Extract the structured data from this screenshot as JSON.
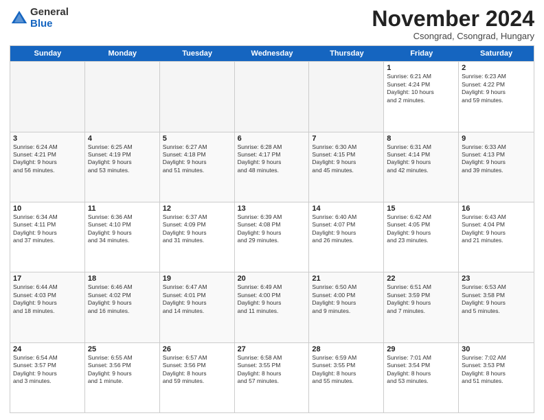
{
  "header": {
    "logo_line1": "General",
    "logo_line2": "Blue",
    "month": "November 2024",
    "location": "Csongrad, Csongrad, Hungary"
  },
  "weekdays": [
    "Sunday",
    "Monday",
    "Tuesday",
    "Wednesday",
    "Thursday",
    "Friday",
    "Saturday"
  ],
  "rows": [
    [
      {
        "day": "",
        "text": "",
        "empty": true
      },
      {
        "day": "",
        "text": "",
        "empty": true
      },
      {
        "day": "",
        "text": "",
        "empty": true
      },
      {
        "day": "",
        "text": "",
        "empty": true
      },
      {
        "day": "",
        "text": "",
        "empty": true
      },
      {
        "day": "1",
        "text": "Sunrise: 6:21 AM\nSunset: 4:24 PM\nDaylight: 10 hours\nand 2 minutes.",
        "empty": false
      },
      {
        "day": "2",
        "text": "Sunrise: 6:23 AM\nSunset: 4:22 PM\nDaylight: 9 hours\nand 59 minutes.",
        "empty": false
      }
    ],
    [
      {
        "day": "3",
        "text": "Sunrise: 6:24 AM\nSunset: 4:21 PM\nDaylight: 9 hours\nand 56 minutes.",
        "empty": false
      },
      {
        "day": "4",
        "text": "Sunrise: 6:25 AM\nSunset: 4:19 PM\nDaylight: 9 hours\nand 53 minutes.",
        "empty": false
      },
      {
        "day": "5",
        "text": "Sunrise: 6:27 AM\nSunset: 4:18 PM\nDaylight: 9 hours\nand 51 minutes.",
        "empty": false
      },
      {
        "day": "6",
        "text": "Sunrise: 6:28 AM\nSunset: 4:17 PM\nDaylight: 9 hours\nand 48 minutes.",
        "empty": false
      },
      {
        "day": "7",
        "text": "Sunrise: 6:30 AM\nSunset: 4:15 PM\nDaylight: 9 hours\nand 45 minutes.",
        "empty": false
      },
      {
        "day": "8",
        "text": "Sunrise: 6:31 AM\nSunset: 4:14 PM\nDaylight: 9 hours\nand 42 minutes.",
        "empty": false
      },
      {
        "day": "9",
        "text": "Sunrise: 6:33 AM\nSunset: 4:13 PM\nDaylight: 9 hours\nand 39 minutes.",
        "empty": false
      }
    ],
    [
      {
        "day": "10",
        "text": "Sunrise: 6:34 AM\nSunset: 4:11 PM\nDaylight: 9 hours\nand 37 minutes.",
        "empty": false
      },
      {
        "day": "11",
        "text": "Sunrise: 6:36 AM\nSunset: 4:10 PM\nDaylight: 9 hours\nand 34 minutes.",
        "empty": false
      },
      {
        "day": "12",
        "text": "Sunrise: 6:37 AM\nSunset: 4:09 PM\nDaylight: 9 hours\nand 31 minutes.",
        "empty": false
      },
      {
        "day": "13",
        "text": "Sunrise: 6:39 AM\nSunset: 4:08 PM\nDaylight: 9 hours\nand 29 minutes.",
        "empty": false
      },
      {
        "day": "14",
        "text": "Sunrise: 6:40 AM\nSunset: 4:07 PM\nDaylight: 9 hours\nand 26 minutes.",
        "empty": false
      },
      {
        "day": "15",
        "text": "Sunrise: 6:42 AM\nSunset: 4:05 PM\nDaylight: 9 hours\nand 23 minutes.",
        "empty": false
      },
      {
        "day": "16",
        "text": "Sunrise: 6:43 AM\nSunset: 4:04 PM\nDaylight: 9 hours\nand 21 minutes.",
        "empty": false
      }
    ],
    [
      {
        "day": "17",
        "text": "Sunrise: 6:44 AM\nSunset: 4:03 PM\nDaylight: 9 hours\nand 18 minutes.",
        "empty": false
      },
      {
        "day": "18",
        "text": "Sunrise: 6:46 AM\nSunset: 4:02 PM\nDaylight: 9 hours\nand 16 minutes.",
        "empty": false
      },
      {
        "day": "19",
        "text": "Sunrise: 6:47 AM\nSunset: 4:01 PM\nDaylight: 9 hours\nand 14 minutes.",
        "empty": false
      },
      {
        "day": "20",
        "text": "Sunrise: 6:49 AM\nSunset: 4:00 PM\nDaylight: 9 hours\nand 11 minutes.",
        "empty": false
      },
      {
        "day": "21",
        "text": "Sunrise: 6:50 AM\nSunset: 4:00 PM\nDaylight: 9 hours\nand 9 minutes.",
        "empty": false
      },
      {
        "day": "22",
        "text": "Sunrise: 6:51 AM\nSunset: 3:59 PM\nDaylight: 9 hours\nand 7 minutes.",
        "empty": false
      },
      {
        "day": "23",
        "text": "Sunrise: 6:53 AM\nSunset: 3:58 PM\nDaylight: 9 hours\nand 5 minutes.",
        "empty": false
      }
    ],
    [
      {
        "day": "24",
        "text": "Sunrise: 6:54 AM\nSunset: 3:57 PM\nDaylight: 9 hours\nand 3 minutes.",
        "empty": false
      },
      {
        "day": "25",
        "text": "Sunrise: 6:55 AM\nSunset: 3:56 PM\nDaylight: 9 hours\nand 1 minute.",
        "empty": false
      },
      {
        "day": "26",
        "text": "Sunrise: 6:57 AM\nSunset: 3:56 PM\nDaylight: 8 hours\nand 59 minutes.",
        "empty": false
      },
      {
        "day": "27",
        "text": "Sunrise: 6:58 AM\nSunset: 3:55 PM\nDaylight: 8 hours\nand 57 minutes.",
        "empty": false
      },
      {
        "day": "28",
        "text": "Sunrise: 6:59 AM\nSunset: 3:55 PM\nDaylight: 8 hours\nand 55 minutes.",
        "empty": false
      },
      {
        "day": "29",
        "text": "Sunrise: 7:01 AM\nSunset: 3:54 PM\nDaylight: 8 hours\nand 53 minutes.",
        "empty": false
      },
      {
        "day": "30",
        "text": "Sunrise: 7:02 AM\nSunset: 3:53 PM\nDaylight: 8 hours\nand 51 minutes.",
        "empty": false
      }
    ]
  ]
}
